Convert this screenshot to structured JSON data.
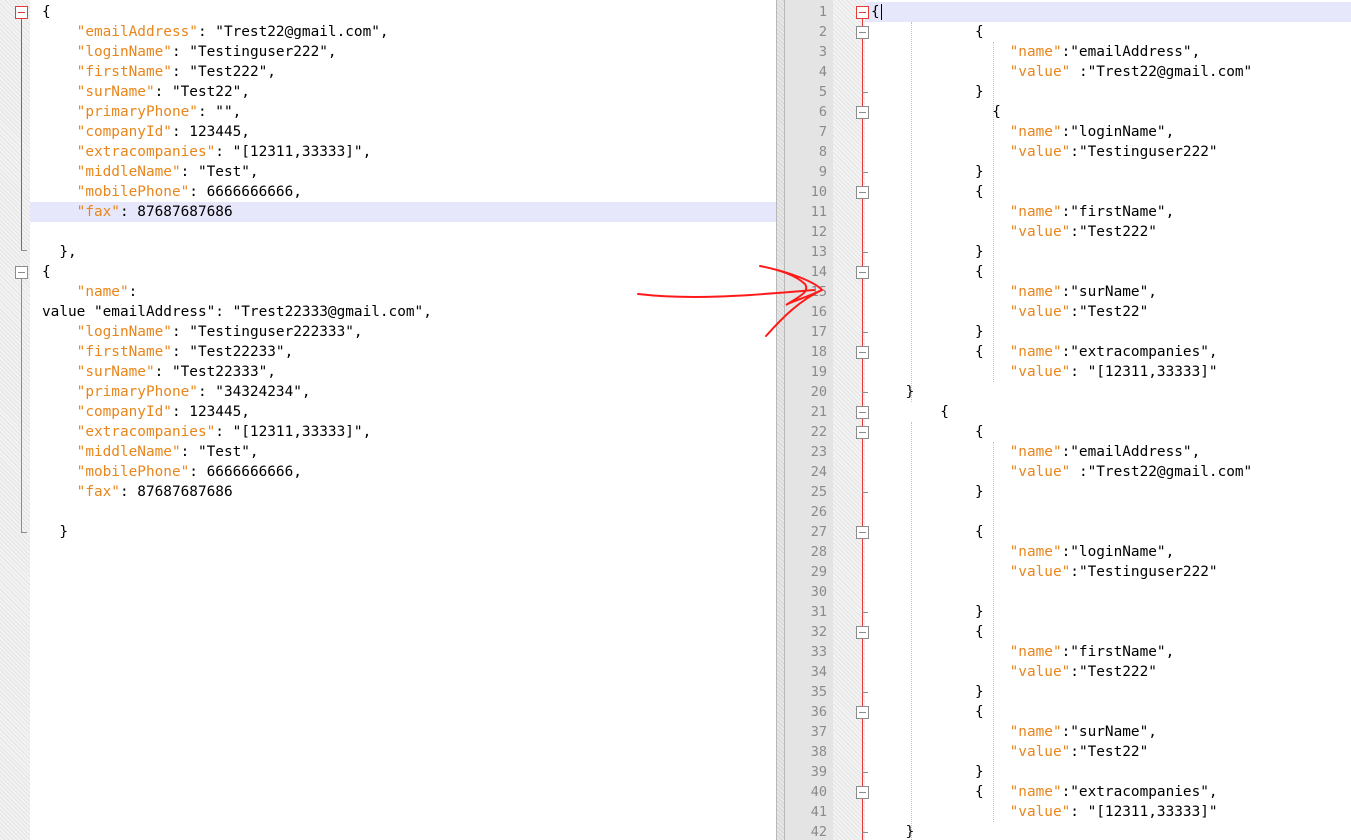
{
  "colors": {
    "key": "#e8861c",
    "text": "#000000",
    "fold": "#e33a3a",
    "highlight": "#e7e7fb",
    "annotation": "#ff0000"
  },
  "left_pane": {
    "lines": [
      {
        "segments": [
          {
            "t": "{",
            "k": false
          }
        ]
      },
      {
        "segments": [
          {
            "t": "    ",
            "k": false
          },
          {
            "t": "\"emailAddress\"",
            "k": true
          },
          {
            "t": ": \"Trest22@gmail.com\",",
            "k": false
          }
        ]
      },
      {
        "segments": [
          {
            "t": "    ",
            "k": false
          },
          {
            "t": "\"loginName\"",
            "k": true
          },
          {
            "t": ": \"Testinguser222\",",
            "k": false
          }
        ]
      },
      {
        "segments": [
          {
            "t": "    ",
            "k": false
          },
          {
            "t": "\"firstName\"",
            "k": true
          },
          {
            "t": ": \"Test222\",",
            "k": false
          }
        ]
      },
      {
        "segments": [
          {
            "t": "    ",
            "k": false
          },
          {
            "t": "\"surName\"",
            "k": true
          },
          {
            "t": ": \"Test22\",",
            "k": false
          }
        ]
      },
      {
        "segments": [
          {
            "t": "    ",
            "k": false
          },
          {
            "t": "\"primaryPhone\"",
            "k": true
          },
          {
            "t": ": \"\",",
            "k": false
          }
        ]
      },
      {
        "segments": [
          {
            "t": "    ",
            "k": false
          },
          {
            "t": "\"companyId\"",
            "k": true
          },
          {
            "t": ": 123445,",
            "k": false
          }
        ]
      },
      {
        "segments": [
          {
            "t": "    ",
            "k": false
          },
          {
            "t": "\"extracompanies\"",
            "k": true
          },
          {
            "t": ": \"[12311,33333]\",",
            "k": false
          }
        ]
      },
      {
        "segments": [
          {
            "t": "    ",
            "k": false
          },
          {
            "t": "\"middleName\"",
            "k": true
          },
          {
            "t": ": \"Test\",",
            "k": false
          }
        ]
      },
      {
        "segments": [
          {
            "t": "    ",
            "k": false
          },
          {
            "t": "\"mobilePhone\"",
            "k": true
          },
          {
            "t": ": 6666666666,",
            "k": false
          }
        ]
      },
      {
        "segments": [
          {
            "t": "    ",
            "k": false
          },
          {
            "t": "\"fax\"",
            "k": true
          },
          {
            "t": ": 87687687686",
            "k": false
          }
        ]
      },
      {
        "segments": []
      },
      {
        "segments": [
          {
            "t": "  },",
            "k": false
          }
        ]
      },
      {
        "segments": [
          {
            "t": "{",
            "k": false
          }
        ]
      },
      {
        "segments": [
          {
            "t": "    ",
            "k": false
          },
          {
            "t": "\"name\"",
            "k": true
          },
          {
            "t": ":",
            "k": false
          }
        ]
      },
      {
        "segments": [
          {
            "t": "value \"emailAddress\": \"Trest22333@gmail.com\",",
            "k": false
          }
        ]
      },
      {
        "segments": [
          {
            "t": "    ",
            "k": false
          },
          {
            "t": "\"loginName\"",
            "k": true
          },
          {
            "t": ": \"Testinguser222333\",",
            "k": false
          }
        ]
      },
      {
        "segments": [
          {
            "t": "    ",
            "k": false
          },
          {
            "t": "\"firstName\"",
            "k": true
          },
          {
            "t": ": \"Test22233\",",
            "k": false
          }
        ]
      },
      {
        "segments": [
          {
            "t": "    ",
            "k": false
          },
          {
            "t": "\"surName\"",
            "k": true
          },
          {
            "t": ": \"Test22333\",",
            "k": false
          }
        ]
      },
      {
        "segments": [
          {
            "t": "    ",
            "k": false
          },
          {
            "t": "\"primaryPhone\"",
            "k": true
          },
          {
            "t": ": \"34324234\",",
            "k": false
          }
        ]
      },
      {
        "segments": [
          {
            "t": "    ",
            "k": false
          },
          {
            "t": "\"companyId\"",
            "k": true
          },
          {
            "t": ": 123445,",
            "k": false
          }
        ]
      },
      {
        "segments": [
          {
            "t": "    ",
            "k": false
          },
          {
            "t": "\"extracompanies\"",
            "k": true
          },
          {
            "t": ": \"[12311,33333]\",",
            "k": false
          }
        ]
      },
      {
        "segments": [
          {
            "t": "    ",
            "k": false
          },
          {
            "t": "\"middleName\"",
            "k": true
          },
          {
            "t": ": \"Test\",",
            "k": false
          }
        ]
      },
      {
        "segments": [
          {
            "t": "    ",
            "k": false
          },
          {
            "t": "\"mobilePhone\"",
            "k": true
          },
          {
            "t": ": 6666666666,",
            "k": false
          }
        ]
      },
      {
        "segments": [
          {
            "t": "    ",
            "k": false
          },
          {
            "t": "\"fax\"",
            "k": true
          },
          {
            "t": ": 87687687686",
            "k": false
          }
        ]
      },
      {
        "segments": []
      },
      {
        "segments": [
          {
            "t": "  }",
            "k": false
          }
        ]
      }
    ]
  },
  "right_pane": {
    "lines": [
      {
        "num": "1",
        "segments": [
          {
            "t": "{",
            "k": false
          }
        ]
      },
      {
        "num": "2",
        "segments": [
          {
            "t": "            {",
            "k": false
          }
        ]
      },
      {
        "num": "3",
        "segments": [
          {
            "t": "                ",
            "k": false
          },
          {
            "t": "\"name\"",
            "k": true
          },
          {
            "t": ":\"emailAddress\",",
            "k": false
          }
        ]
      },
      {
        "num": "4",
        "segments": [
          {
            "t": "                ",
            "k": false
          },
          {
            "t": "\"value\"",
            "k": true
          },
          {
            "t": " :\"Trest22@gmail.com\"",
            "k": false
          }
        ]
      },
      {
        "num": "5",
        "segments": [
          {
            "t": "            }",
            "k": false
          }
        ]
      },
      {
        "num": "6",
        "segments": [
          {
            "t": "              {",
            "k": false
          }
        ]
      },
      {
        "num": "7",
        "segments": [
          {
            "t": "                ",
            "k": false
          },
          {
            "t": "\"name\"",
            "k": true
          },
          {
            "t": ":\"loginName\",",
            "k": false
          }
        ]
      },
      {
        "num": "8",
        "segments": [
          {
            "t": "                ",
            "k": false
          },
          {
            "t": "\"value\"",
            "k": true
          },
          {
            "t": ":\"Testinguser222\"",
            "k": false
          }
        ]
      },
      {
        "num": "9",
        "segments": [
          {
            "t": "            }",
            "k": false
          }
        ]
      },
      {
        "num": "10",
        "segments": [
          {
            "t": "            {",
            "k": false
          }
        ]
      },
      {
        "num": "11",
        "segments": [
          {
            "t": "                ",
            "k": false
          },
          {
            "t": "\"name\"",
            "k": true
          },
          {
            "t": ":\"firstName\",",
            "k": false
          }
        ]
      },
      {
        "num": "12",
        "segments": [
          {
            "t": "                ",
            "k": false
          },
          {
            "t": "\"value\"",
            "k": true
          },
          {
            "t": ":\"Test222\"",
            "k": false
          }
        ]
      },
      {
        "num": "13",
        "segments": [
          {
            "t": "            }",
            "k": false
          }
        ]
      },
      {
        "num": "14",
        "segments": [
          {
            "t": "            {",
            "k": false
          }
        ]
      },
      {
        "num": "15",
        "segments": [
          {
            "t": "                ",
            "k": false
          },
          {
            "t": "\"name\"",
            "k": true
          },
          {
            "t": ":\"surName\",",
            "k": false
          }
        ]
      },
      {
        "num": "16",
        "segments": [
          {
            "t": "                ",
            "k": false
          },
          {
            "t": "\"value\"",
            "k": true
          },
          {
            "t": ":\"Test22\"",
            "k": false
          }
        ]
      },
      {
        "num": "17",
        "segments": [
          {
            "t": "            }",
            "k": false
          }
        ]
      },
      {
        "num": "18",
        "segments": [
          {
            "t": "            {   ",
            "k": false
          },
          {
            "t": "\"name\"",
            "k": true
          },
          {
            "t": ":\"extracompanies\",",
            "k": false
          }
        ]
      },
      {
        "num": "19",
        "segments": [
          {
            "t": "                ",
            "k": false
          },
          {
            "t": "\"value\"",
            "k": true
          },
          {
            "t": ": \"[12311,33333]\"",
            "k": false
          }
        ]
      },
      {
        "num": "20",
        "segments": [
          {
            "t": "    }",
            "k": false
          }
        ]
      },
      {
        "num": "21",
        "segments": [
          {
            "t": "        {",
            "k": false
          }
        ]
      },
      {
        "num": "22",
        "segments": [
          {
            "t": "            {",
            "k": false
          }
        ]
      },
      {
        "num": "23",
        "segments": [
          {
            "t": "                ",
            "k": false
          },
          {
            "t": "\"name\"",
            "k": true
          },
          {
            "t": ":\"emailAddress\",",
            "k": false
          }
        ]
      },
      {
        "num": "24",
        "segments": [
          {
            "t": "                ",
            "k": false
          },
          {
            "t": "\"value\"",
            "k": true
          },
          {
            "t": " :\"Trest22@gmail.com\"",
            "k": false
          }
        ]
      },
      {
        "num": "25",
        "segments": [
          {
            "t": "            }",
            "k": false
          }
        ]
      },
      {
        "num": "26",
        "segments": []
      },
      {
        "num": "27",
        "segments": [
          {
            "t": "            {",
            "k": false
          }
        ]
      },
      {
        "num": "28",
        "segments": [
          {
            "t": "                ",
            "k": false
          },
          {
            "t": "\"name\"",
            "k": true
          },
          {
            "t": ":\"loginName\",",
            "k": false
          }
        ]
      },
      {
        "num": "29",
        "segments": [
          {
            "t": "                ",
            "k": false
          },
          {
            "t": "\"value\"",
            "k": true
          },
          {
            "t": ":\"Testinguser222\"",
            "k": false
          }
        ]
      },
      {
        "num": "30",
        "segments": []
      },
      {
        "num": "31",
        "segments": [
          {
            "t": "            }",
            "k": false
          }
        ]
      },
      {
        "num": "32",
        "segments": [
          {
            "t": "            {",
            "k": false
          }
        ]
      },
      {
        "num": "33",
        "segments": [
          {
            "t": "                ",
            "k": false
          },
          {
            "t": "\"name\"",
            "k": true
          },
          {
            "t": ":\"firstName\",",
            "k": false
          }
        ]
      },
      {
        "num": "34",
        "segments": [
          {
            "t": "                ",
            "k": false
          },
          {
            "t": "\"value\"",
            "k": true
          },
          {
            "t": ":\"Test222\"",
            "k": false
          }
        ]
      },
      {
        "num": "35",
        "segments": [
          {
            "t": "            }",
            "k": false
          }
        ]
      },
      {
        "num": "36",
        "segments": [
          {
            "t": "            {",
            "k": false
          }
        ]
      },
      {
        "num": "37",
        "segments": [
          {
            "t": "                ",
            "k": false
          },
          {
            "t": "\"name\"",
            "k": true
          },
          {
            "t": ":\"surName\",",
            "k": false
          }
        ]
      },
      {
        "num": "38",
        "segments": [
          {
            "t": "                ",
            "k": false
          },
          {
            "t": "\"value\"",
            "k": true
          },
          {
            "t": ":\"Test22\"",
            "k": false
          }
        ]
      },
      {
        "num": "39",
        "segments": [
          {
            "t": "            }",
            "k": false
          }
        ]
      },
      {
        "num": "40",
        "segments": [
          {
            "t": "            {   ",
            "k": false
          },
          {
            "t": "\"name\"",
            "k": true
          },
          {
            "t": ":\"extracompanies\",",
            "k": false
          }
        ]
      },
      {
        "num": "41",
        "segments": [
          {
            "t": "                ",
            "k": false
          },
          {
            "t": "\"value\"",
            "k": true
          },
          {
            "t": ": \"[12311,33333]\"",
            "k": false
          }
        ]
      },
      {
        "num": "42",
        "segments": [
          {
            "t": "    }",
            "k": false
          }
        ]
      }
    ]
  }
}
